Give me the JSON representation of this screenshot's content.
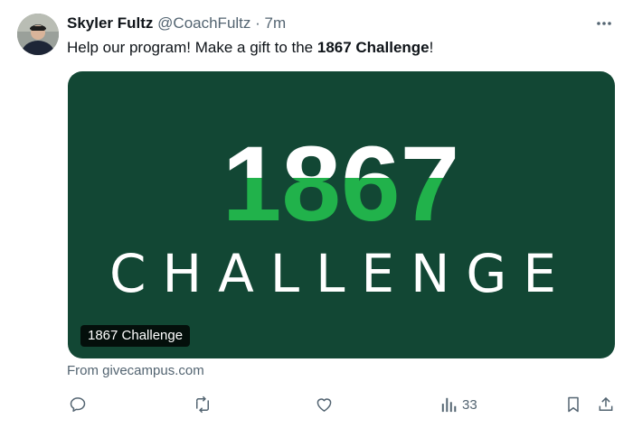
{
  "tweet": {
    "author_name": "Skyler Fultz",
    "author_handle": "@CoachFultz",
    "separator": "·",
    "time": "7m",
    "text_before": "Help our program! Make a gift to the ",
    "text_bold": "1867 Challenge",
    "text_after": "!"
  },
  "card": {
    "logo_number": "1867",
    "logo_word": "CHALLENGE",
    "caption": "1867 Challenge",
    "source": "From givecampus.com",
    "colors": {
      "background": "#124734",
      "accent": "#21b24b",
      "text": "#ffffff"
    }
  },
  "actions": {
    "reply_icon": "reply-icon",
    "retweet_icon": "retweet-icon",
    "like_icon": "like-icon",
    "views_icon": "views-icon",
    "views_count": "33",
    "bookmark_icon": "bookmark-icon",
    "share_icon": "share-icon",
    "more_icon": "more-icon"
  }
}
